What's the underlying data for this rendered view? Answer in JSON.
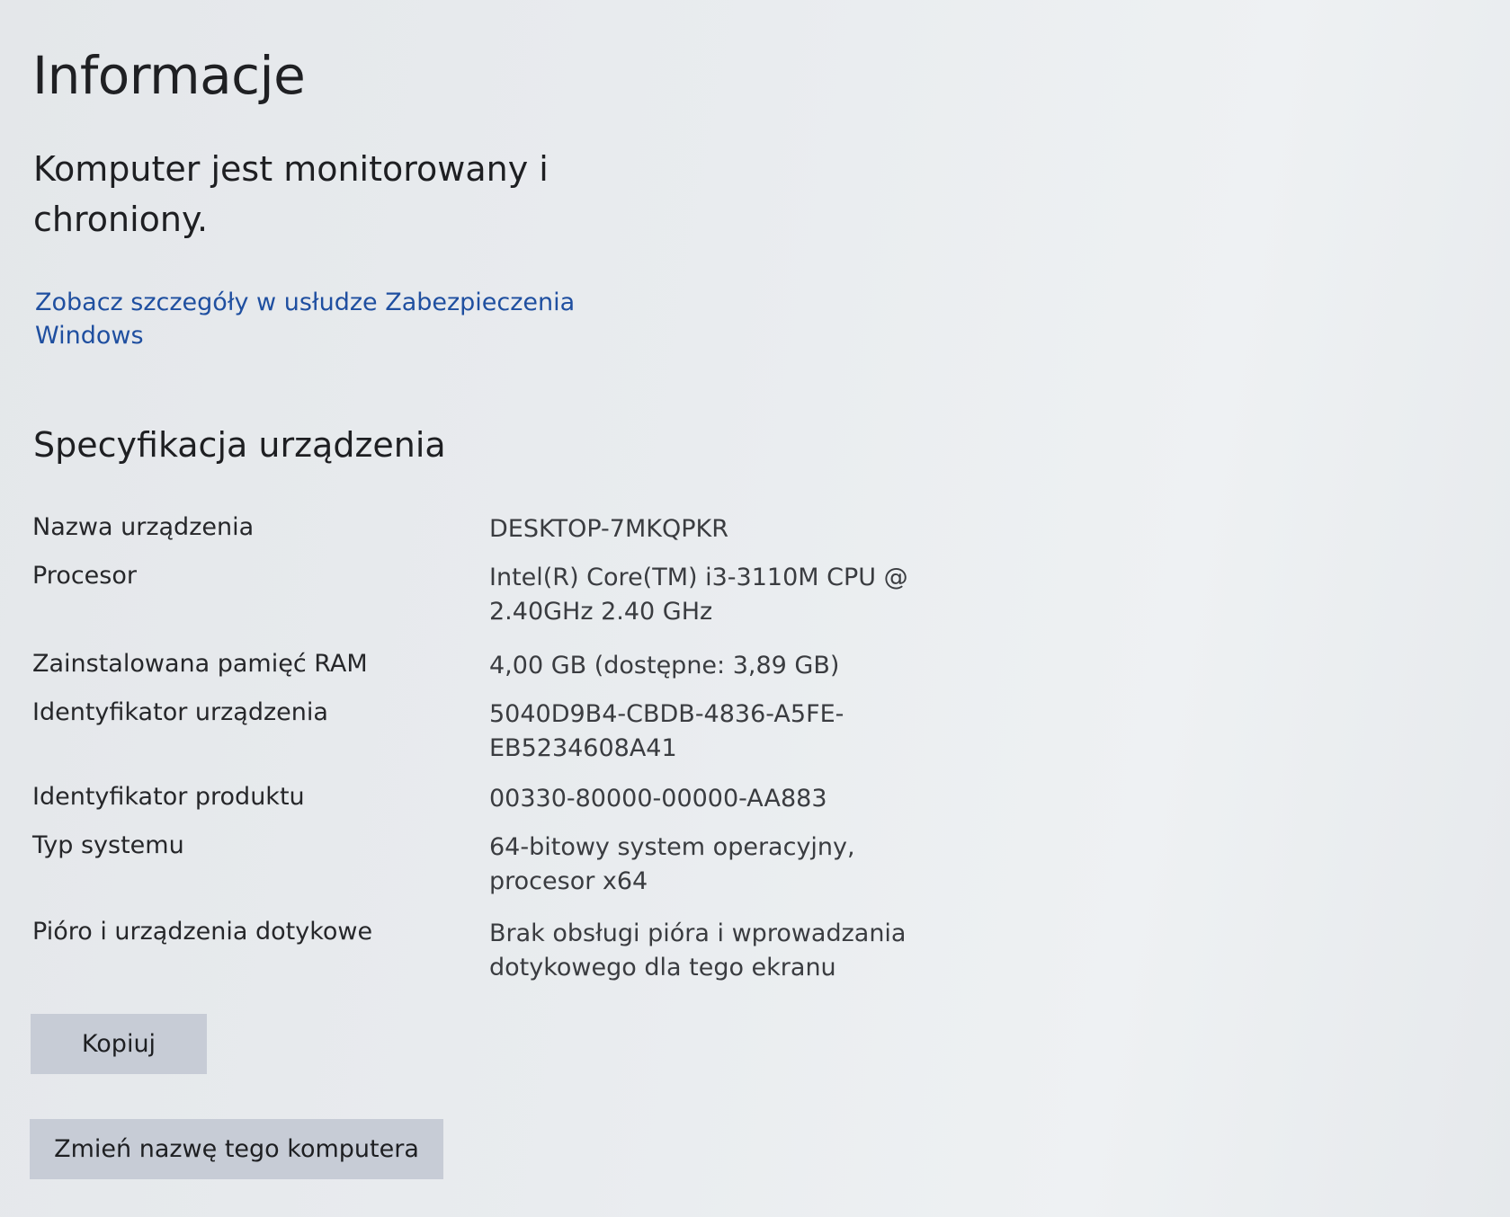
{
  "page": {
    "title": "Informacje",
    "status": "Komputer jest monitorowany i chroniony.",
    "security_link": "Zobacz szczegóły w usłudze Zabezpieczenia Windows"
  },
  "specs": {
    "heading": "Specyfikacja urządzenia",
    "rows": [
      {
        "label": "Nazwa urządzenia",
        "value": "DESKTOP-7MKQPKR"
      },
      {
        "label": "Procesor",
        "value": "Intel(R) Core(TM) i3-3110M CPU @ 2.40GHz   2.40 GHz"
      },
      {
        "label": "Zainstalowana pamięć RAM",
        "value": "4,00 GB (dostępne: 3,89 GB)"
      },
      {
        "label": "Identyfikator urządzenia",
        "value": "5040D9B4-CBDB-4836-A5FE-EB5234608A41"
      },
      {
        "label": "Identyfikator produktu",
        "value": "00330-80000-00000-AA883"
      },
      {
        "label": "Typ systemu",
        "value": "64-bitowy system operacyjny, procesor x64"
      },
      {
        "label": "Pióro i urządzenia dotykowe",
        "value": "Brak obsługi pióra i wprowadzania dotykowego dla tego ekranu"
      }
    ]
  },
  "buttons": {
    "copy": "Kopiuj",
    "rename": "Zmień nazwę tego komputera"
  },
  "colors": {
    "link": "#1f4fa0",
    "button_bg": "#c7ccd6",
    "background": "#e9ecef"
  }
}
